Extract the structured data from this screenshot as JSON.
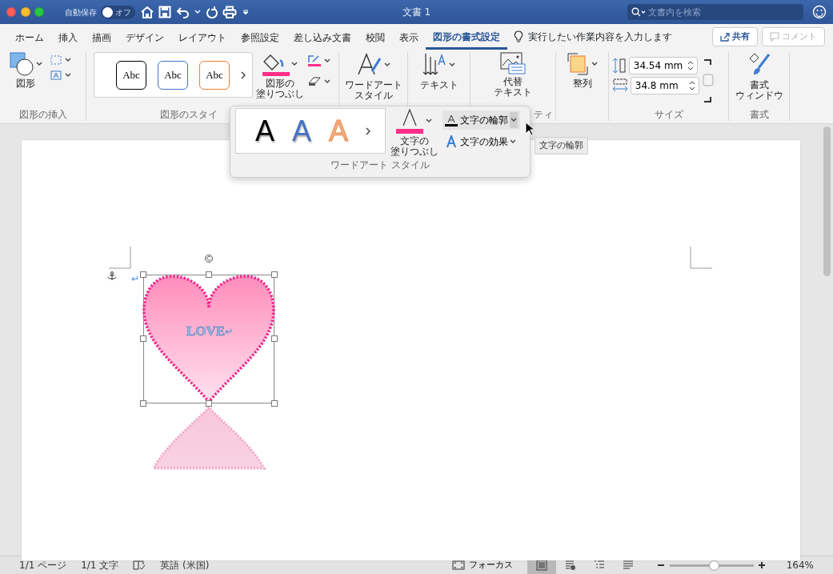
{
  "window": {
    "title": "文書 1",
    "autosave_label": "自動保存",
    "autosave_toggle": {
      "on": false,
      "label": "オフ"
    },
    "search": {
      "placeholder": "文書内を検索"
    }
  },
  "tabs": [
    {
      "label": "ホーム",
      "selected": false
    },
    {
      "label": "挿入",
      "selected": false
    },
    {
      "label": "描画",
      "selected": false
    },
    {
      "label": "デザイン",
      "selected": false
    },
    {
      "label": "レイアウト",
      "selected": false
    },
    {
      "label": "参照設定",
      "selected": false
    },
    {
      "label": "差し込み文書",
      "selected": false
    },
    {
      "label": "校閲",
      "selected": false
    },
    {
      "label": "表示",
      "selected": false
    },
    {
      "label": "図形の書式設定",
      "selected": true
    }
  ],
  "tell_me": "実行したい作業内容を入力します",
  "share_button": "共有",
  "comment_button": {
    "label": "コメント",
    "disabled": true
  },
  "ribbon": {
    "insert_shapes": {
      "shapes_label": "図形",
      "group_label": "図形の挿入"
    },
    "shape_styles": {
      "presets": [
        {
          "label": "Abc",
          "color": "#000000"
        },
        {
          "label": "Abc",
          "color": "#4472c4"
        },
        {
          "label": "Abc",
          "color": "#ed7d31"
        }
      ],
      "fill_label": [
        "図形の",
        "塗りつぶし"
      ],
      "group_label": "図形のスタイ"
    },
    "wordart_label": [
      "ワードアート",
      "スタイル"
    ],
    "text_label": "テキスト",
    "alt_text_label": [
      "代替",
      "テキスト"
    ],
    "accessibility_group_label": "ティ",
    "arrange_label": "整列",
    "size": {
      "height": "34.54 mm",
      "width": "34.8 mm",
      "group_label": "サイズ"
    },
    "format": {
      "pane_label": [
        "書式",
        "ウィンドウ"
      ],
      "group_label": "書式"
    }
  },
  "wordart_popup": {
    "presets": [
      {
        "label": "A",
        "color": "#000000"
      },
      {
        "label": "A",
        "color": "#4472c4"
      },
      {
        "label": "A",
        "color": "#f4b183"
      }
    ],
    "text_fill_label": [
      "文字の",
      "塗りつぶし"
    ],
    "text_outline_label": "文字の輪郭",
    "text_effects_label": "文字の効果",
    "group_label": "ワードアート スタイル",
    "tooltip": "文字の輪郭"
  },
  "document": {
    "paragraph_mark": "↵",
    "shape_text": "LOVE",
    "shape_paragraph_mark": "↵"
  },
  "status_bar": {
    "pages": "1/1 ページ",
    "words": "1/1 文字",
    "language": "英語 (米国)",
    "focus": "フォーカス",
    "views": [
      {
        "kind": "print",
        "selected": true
      },
      {
        "kind": "web",
        "selected": false
      },
      {
        "kind": "outline",
        "selected": false
      },
      {
        "kind": "draft",
        "selected": false
      }
    ],
    "zoom": {
      "level": 0.53,
      "reading": "164%"
    }
  }
}
